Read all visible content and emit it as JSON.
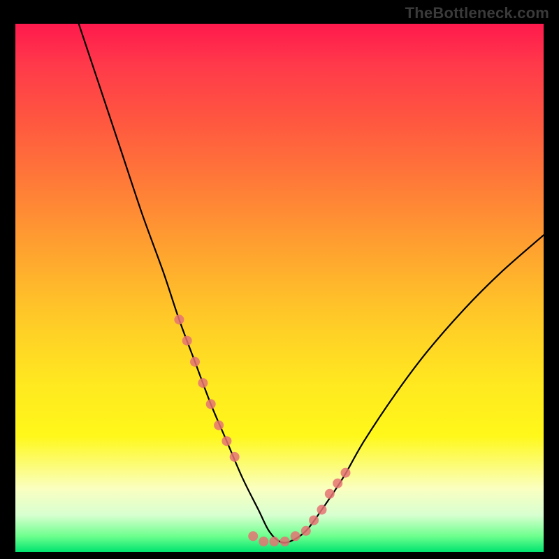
{
  "attribution": "TheBottleneck.com",
  "chart_data": {
    "type": "line",
    "title": "",
    "xlabel": "",
    "ylabel": "",
    "xlim": [
      0,
      100
    ],
    "ylim": [
      0,
      100
    ],
    "grid": false,
    "series": [
      {
        "name": "bottleneck-curve",
        "x": [
          12,
          16,
          20,
          24,
          28,
          31,
          34,
          37,
          40,
          43,
          46,
          48,
          50,
          52,
          55,
          58,
          62,
          66,
          72,
          78,
          85,
          92,
          100
        ],
        "y": [
          100,
          88,
          76,
          64,
          53,
          44,
          36,
          28,
          21,
          14,
          8,
          4,
          2,
          2,
          4,
          8,
          14,
          21,
          30,
          38,
          46,
          53,
          60
        ]
      },
      {
        "name": "left-markers",
        "x": [
          31,
          32.5,
          34,
          35.5,
          37,
          38.5,
          40,
          41.5
        ],
        "y": [
          44,
          40,
          36,
          32,
          28,
          24,
          21,
          18
        ]
      },
      {
        "name": "right-markers",
        "x": [
          55,
          56.5,
          58,
          59.5,
          61,
          62.5
        ],
        "y": [
          4,
          6,
          8,
          11,
          13,
          15
        ]
      },
      {
        "name": "bottom-markers",
        "x": [
          45,
          47,
          49,
          51,
          53
        ],
        "y": [
          3,
          2,
          2,
          2,
          3
        ]
      }
    ],
    "legend": false,
    "colors": {
      "curve": "#000000",
      "markers": "#e57373"
    }
  }
}
